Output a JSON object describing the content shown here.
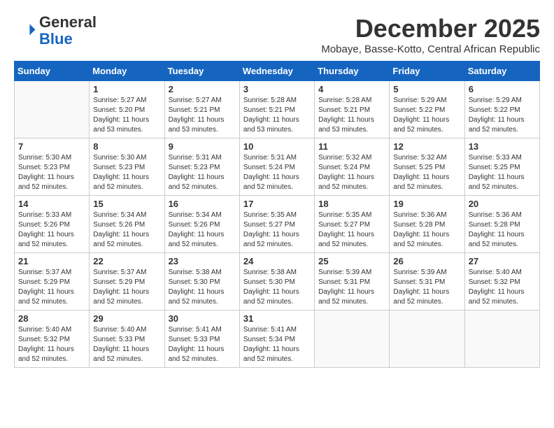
{
  "logo": {
    "general": "General",
    "blue": "Blue"
  },
  "title": "December 2025",
  "subtitle": "Mobaye, Basse-Kotto, Central African Republic",
  "days_of_week": [
    "Sunday",
    "Monday",
    "Tuesday",
    "Wednesday",
    "Thursday",
    "Friday",
    "Saturday"
  ],
  "weeks": [
    [
      {
        "day": "",
        "info": ""
      },
      {
        "day": "1",
        "info": "Sunrise: 5:27 AM\nSunset: 5:20 PM\nDaylight: 11 hours\nand 53 minutes."
      },
      {
        "day": "2",
        "info": "Sunrise: 5:27 AM\nSunset: 5:21 PM\nDaylight: 11 hours\nand 53 minutes."
      },
      {
        "day": "3",
        "info": "Sunrise: 5:28 AM\nSunset: 5:21 PM\nDaylight: 11 hours\nand 53 minutes."
      },
      {
        "day": "4",
        "info": "Sunrise: 5:28 AM\nSunset: 5:21 PM\nDaylight: 11 hours\nand 53 minutes."
      },
      {
        "day": "5",
        "info": "Sunrise: 5:29 AM\nSunset: 5:22 PM\nDaylight: 11 hours\nand 52 minutes."
      },
      {
        "day": "6",
        "info": "Sunrise: 5:29 AM\nSunset: 5:22 PM\nDaylight: 11 hours\nand 52 minutes."
      }
    ],
    [
      {
        "day": "7",
        "info": "Sunrise: 5:30 AM\nSunset: 5:23 PM\nDaylight: 11 hours\nand 52 minutes."
      },
      {
        "day": "8",
        "info": "Sunrise: 5:30 AM\nSunset: 5:23 PM\nDaylight: 11 hours\nand 52 minutes."
      },
      {
        "day": "9",
        "info": "Sunrise: 5:31 AM\nSunset: 5:23 PM\nDaylight: 11 hours\nand 52 minutes."
      },
      {
        "day": "10",
        "info": "Sunrise: 5:31 AM\nSunset: 5:24 PM\nDaylight: 11 hours\nand 52 minutes."
      },
      {
        "day": "11",
        "info": "Sunrise: 5:32 AM\nSunset: 5:24 PM\nDaylight: 11 hours\nand 52 minutes."
      },
      {
        "day": "12",
        "info": "Sunrise: 5:32 AM\nSunset: 5:25 PM\nDaylight: 11 hours\nand 52 minutes."
      },
      {
        "day": "13",
        "info": "Sunrise: 5:33 AM\nSunset: 5:25 PM\nDaylight: 11 hours\nand 52 minutes."
      }
    ],
    [
      {
        "day": "14",
        "info": "Sunrise: 5:33 AM\nSunset: 5:26 PM\nDaylight: 11 hours\nand 52 minutes."
      },
      {
        "day": "15",
        "info": "Sunrise: 5:34 AM\nSunset: 5:26 PM\nDaylight: 11 hours\nand 52 minutes."
      },
      {
        "day": "16",
        "info": "Sunrise: 5:34 AM\nSunset: 5:26 PM\nDaylight: 11 hours\nand 52 minutes."
      },
      {
        "day": "17",
        "info": "Sunrise: 5:35 AM\nSunset: 5:27 PM\nDaylight: 11 hours\nand 52 minutes."
      },
      {
        "day": "18",
        "info": "Sunrise: 5:35 AM\nSunset: 5:27 PM\nDaylight: 11 hours\nand 52 minutes."
      },
      {
        "day": "19",
        "info": "Sunrise: 5:36 AM\nSunset: 5:28 PM\nDaylight: 11 hours\nand 52 minutes."
      },
      {
        "day": "20",
        "info": "Sunrise: 5:36 AM\nSunset: 5:28 PM\nDaylight: 11 hours\nand 52 minutes."
      }
    ],
    [
      {
        "day": "21",
        "info": "Sunrise: 5:37 AM\nSunset: 5:29 PM\nDaylight: 11 hours\nand 52 minutes."
      },
      {
        "day": "22",
        "info": "Sunrise: 5:37 AM\nSunset: 5:29 PM\nDaylight: 11 hours\nand 52 minutes."
      },
      {
        "day": "23",
        "info": "Sunrise: 5:38 AM\nSunset: 5:30 PM\nDaylight: 11 hours\nand 52 minutes."
      },
      {
        "day": "24",
        "info": "Sunrise: 5:38 AM\nSunset: 5:30 PM\nDaylight: 11 hours\nand 52 minutes."
      },
      {
        "day": "25",
        "info": "Sunrise: 5:39 AM\nSunset: 5:31 PM\nDaylight: 11 hours\nand 52 minutes."
      },
      {
        "day": "26",
        "info": "Sunrise: 5:39 AM\nSunset: 5:31 PM\nDaylight: 11 hours\nand 52 minutes."
      },
      {
        "day": "27",
        "info": "Sunrise: 5:40 AM\nSunset: 5:32 PM\nDaylight: 11 hours\nand 52 minutes."
      }
    ],
    [
      {
        "day": "28",
        "info": "Sunrise: 5:40 AM\nSunset: 5:32 PM\nDaylight: 11 hours\nand 52 minutes."
      },
      {
        "day": "29",
        "info": "Sunrise: 5:40 AM\nSunset: 5:33 PM\nDaylight: 11 hours\nand 52 minutes."
      },
      {
        "day": "30",
        "info": "Sunrise: 5:41 AM\nSunset: 5:33 PM\nDaylight: 11 hours\nand 52 minutes."
      },
      {
        "day": "31",
        "info": "Sunrise: 5:41 AM\nSunset: 5:34 PM\nDaylight: 11 hours\nand 52 minutes."
      },
      {
        "day": "",
        "info": ""
      },
      {
        "day": "",
        "info": ""
      },
      {
        "day": "",
        "info": ""
      }
    ]
  ]
}
